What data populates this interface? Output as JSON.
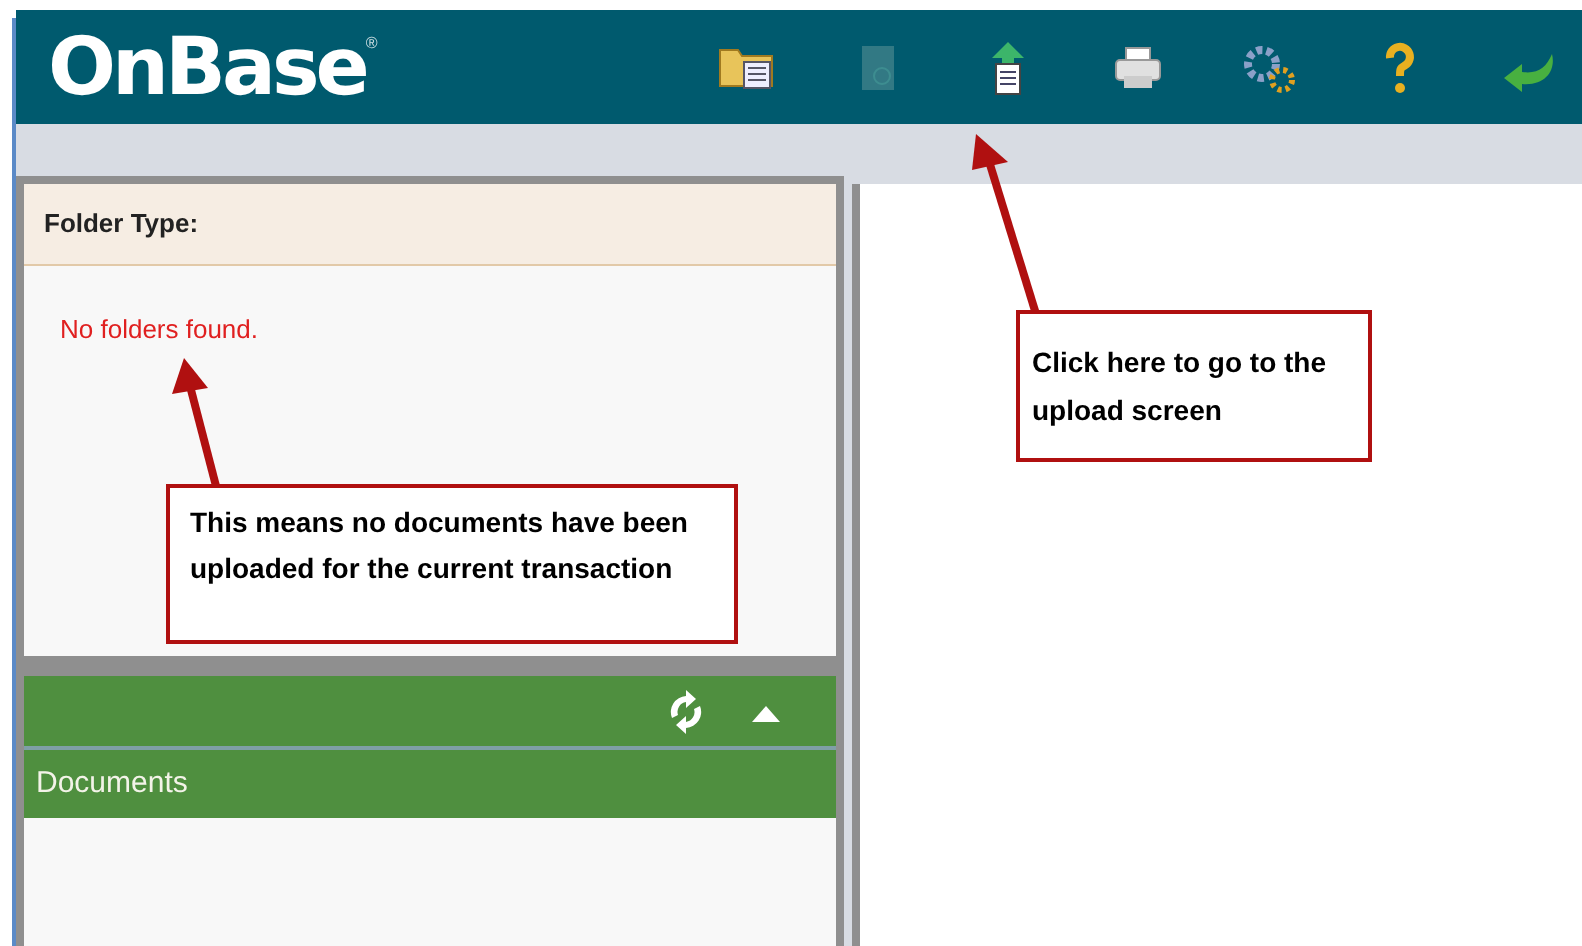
{
  "header": {
    "logo": "OnBase",
    "logo_mark": "®",
    "toolbar": [
      {
        "kind": "folder",
        "disabled": false
      },
      {
        "kind": "document",
        "disabled": true
      },
      {
        "kind": "upload",
        "disabled": false
      },
      {
        "kind": "print",
        "disabled": false
      },
      {
        "kind": "gears",
        "disabled": false
      },
      {
        "kind": "help",
        "disabled": false
      },
      {
        "kind": "back",
        "disabled": false
      }
    ]
  },
  "folder_panel": {
    "title": "Folder Type:",
    "message": "No folders found."
  },
  "documents_panel": {
    "title": "Documents",
    "expanded": true
  },
  "callouts": [
    {
      "text": "Click here to go to the upload screen"
    },
    {
      "text": "This means no documents have been uploaded for the current transaction"
    }
  ]
}
